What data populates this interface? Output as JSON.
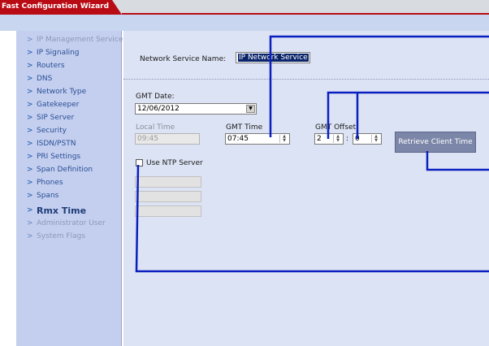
{
  "window": {
    "title": "Fast Configuration Wizard"
  },
  "sidebar": {
    "items": [
      {
        "label": "IP Management Service",
        "state": "disabled"
      },
      {
        "label": "IP Signaling",
        "state": "normal"
      },
      {
        "label": "Routers",
        "state": "normal"
      },
      {
        "label": "DNS",
        "state": "normal"
      },
      {
        "label": "Network Type",
        "state": "normal"
      },
      {
        "label": "Gatekeeper",
        "state": "normal"
      },
      {
        "label": "SIP Server",
        "state": "normal"
      },
      {
        "label": "Security",
        "state": "normal"
      },
      {
        "label": "ISDN/PSTN",
        "state": "normal"
      },
      {
        "label": "PRI Settings",
        "state": "normal"
      },
      {
        "label": "Span Definition",
        "state": "normal"
      },
      {
        "label": "Phones",
        "state": "normal"
      },
      {
        "label": "Spans",
        "state": "normal"
      },
      {
        "label": "Rmx Time",
        "state": "active"
      },
      {
        "label": "Administrator User",
        "state": "disabled"
      },
      {
        "label": "System Flags",
        "state": "disabled"
      }
    ]
  },
  "main": {
    "network_service_name_label": "Network Service Name:",
    "network_service_name_value": "IP Network Service",
    "gmt_date_label": "GMT Date:",
    "gmt_date_value": "12/06/2012",
    "local_time_label": "Local Time",
    "local_time_value": "09:45",
    "gmt_time_label": "GMT Time",
    "gmt_time_value": "07:45",
    "gmt_offset_label": "GMT Offset",
    "gmt_offset_hours": "2",
    "gmt_offset_separator": ":",
    "gmt_offset_minutes": "0",
    "retrieve_button_label": "Retrieve Client Time",
    "use_ntp_label": "Use NTP Server",
    "use_ntp_checked": false,
    "ntp_servers": [
      "",
      "",
      ""
    ]
  },
  "colors": {
    "title_bar": "#b90b14",
    "sidebar_bg": "#c4cff0",
    "panel_bg": "#dce3f4",
    "callout_lines": "#0a1fbf"
  }
}
